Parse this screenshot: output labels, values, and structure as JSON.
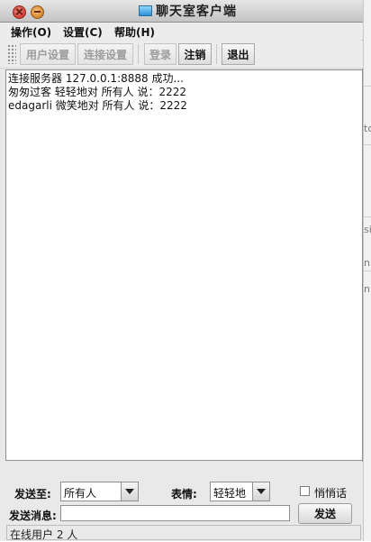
{
  "window": {
    "title": "聊天室客户端"
  },
  "menu": [
    {
      "label": "操作(O)"
    },
    {
      "label": "设置(C)"
    },
    {
      "label": "帮助(H)"
    }
  ],
  "toolbar": {
    "user_settings": "用户设置",
    "connect_settings": "连接设置",
    "login": "登录",
    "logout": "注销",
    "exit": "退出"
  },
  "chat": {
    "messages": [
      "连接服务器 127.0.0.1:8888 成功...",
      "匆匆过客 轻轻地对 所有人 说：2222",
      "edagarli 微笑地对 所有人 说：2222"
    ]
  },
  "compose": {
    "send_to_label": "发送至:",
    "send_to_value": "所有人",
    "expression_label": "表情:",
    "expression_value": "轻轻地",
    "whisper_label": "悄悄话",
    "message_label": "发送消息:",
    "message_value": "",
    "send_button": "发送"
  },
  "status": {
    "online_text": "在线用户 2 人"
  },
  "background": {
    "fragments": [
      "to",
      "si",
      "ni",
      "ni"
    ]
  },
  "colors": {
    "close": "#cf3b2e",
    "minimize": "#d6822a",
    "window_bg": "#e9e9e9"
  }
}
